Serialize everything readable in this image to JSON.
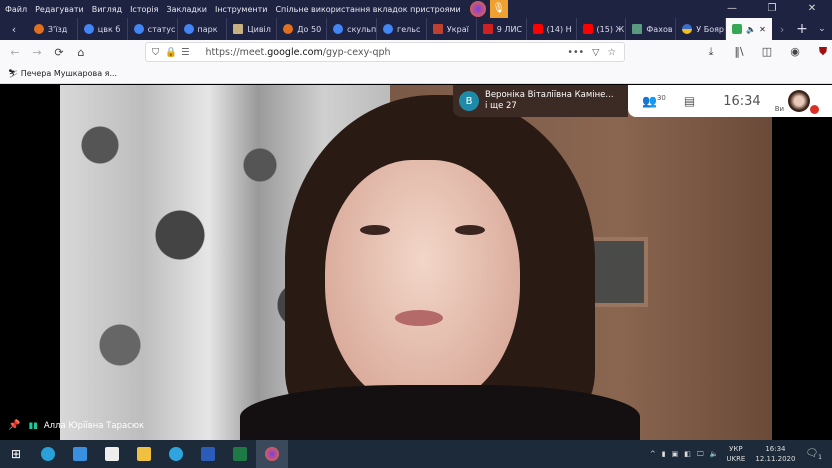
{
  "menu": [
    "Файл",
    "Редагувати",
    "Вигляд",
    "Історія",
    "Закладки",
    "Інструменти",
    "Спільне використання вкладок пристроями"
  ],
  "tabs": [
    {
      "label": "З'їзд",
      "color": "#e07020"
    },
    {
      "label": "цвк б",
      "color": "#4285f4"
    },
    {
      "label": "статус",
      "color": "#4285f4"
    },
    {
      "label": "парк",
      "color": "#4285f4"
    },
    {
      "label": "Цивіл",
      "color": "#c8b080"
    },
    {
      "label": "До 50",
      "color": "#e07020"
    },
    {
      "label": "скульп",
      "color": "#4285f4"
    },
    {
      "label": "гельс",
      "color": "#4285f4"
    },
    {
      "label": "Украї",
      "color": "#c04030"
    },
    {
      "label": "9 ЛИС",
      "color": "#d02020"
    },
    {
      "label": "(14) Н",
      "color": "#ff0000"
    },
    {
      "label": "(15) Ж",
      "color": "#ff0000"
    },
    {
      "label": "Фахов",
      "color": "#5a9a80"
    },
    {
      "label": "У Бояр",
      "color": "#f0c020"
    }
  ],
  "url": {
    "prefix": "https://meet.",
    "domain": "google.com",
    "path": "/gyp-cexy-qph"
  },
  "bookmark": "Печера Мушкарова я...",
  "meet": {
    "presenter_initial": "В",
    "presenter": "Вероніка Віталіївна Каміне...",
    "others": "і ще 27",
    "participants": "30",
    "time": "16:34",
    "you": "Ви"
  },
  "speaker": "Алла Юріївна Тарасюк",
  "tray": {
    "lang1": "УКР",
    "lang2": "UKRE",
    "time": "16:34",
    "date": "12.11.2020",
    "notifications": "1"
  }
}
